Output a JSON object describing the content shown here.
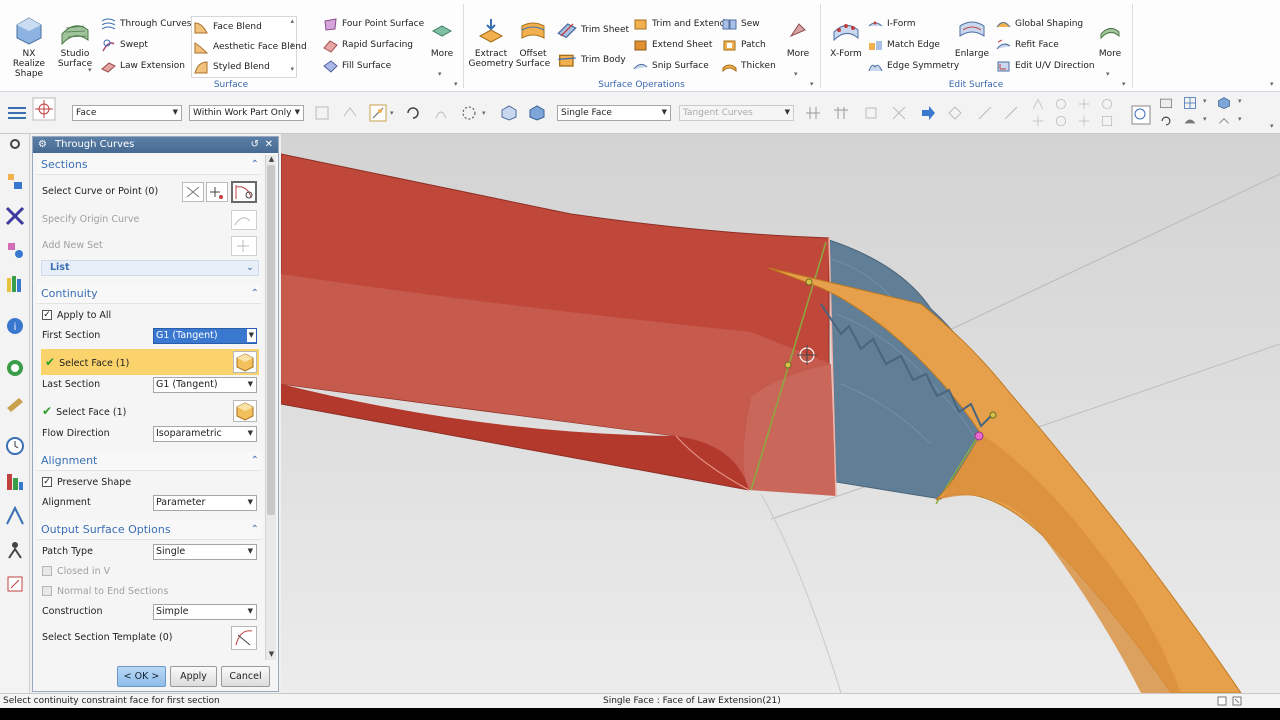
{
  "ribbon": {
    "surface_group": {
      "label": "Surface",
      "big_buttons": [
        "NX Realize Shape",
        "Studio Surface"
      ],
      "column1": [
        "Through Curves",
        "Swept",
        "Law Extension"
      ],
      "gallery": [
        "Face Blend",
        "Aesthetic Face Blend",
        "Styled Blend"
      ],
      "column3": [
        "Four Point Surface",
        "Rapid Surfacing",
        "Fill Surface"
      ],
      "more": "More"
    },
    "surface_ops_group": {
      "label": "Surface Operations",
      "big_buttons": [
        "Extract Geometry",
        "Offset Surface"
      ],
      "column1": [
        "Trim Sheet",
        "Trim Body"
      ],
      "column2": [
        "Trim and Extend",
        "Extend Sheet",
        "Snip Surface"
      ],
      "column3": [
        "Sew",
        "Patch",
        "Thicken"
      ],
      "more": "More"
    },
    "edit_surface_group": {
      "label": "Edit Surface",
      "big_buttons": [
        "X-Form",
        "Enlarge"
      ],
      "column1": [
        "I-Form",
        "Match Edge",
        "Edge Symmetry"
      ],
      "column2": [
        "Global Shaping",
        "Refit Face",
        "Edit U/V Direction"
      ],
      "more": "More"
    }
  },
  "selection_bar": {
    "type_filter": "Face",
    "scope": "Within Work Part Only",
    "face_rule": "Single Face",
    "curve_rule": "Tangent Curves"
  },
  "dialog": {
    "title": "Through Curves",
    "sections": {
      "title": "Sections",
      "select_curve": "Select Curve or Point (0)",
      "origin_curve": "Specify Origin Curve",
      "add_new_set": "Add New Set",
      "list": "List"
    },
    "continuity": {
      "title": "Continuity",
      "apply_to_all": "Apply to All",
      "first_section_label": "First Section",
      "first_section_value": "G1 (Tangent)",
      "first_face": "Select Face (1)",
      "last_section_label": "Last Section",
      "last_section_value": "G1 (Tangent)",
      "last_face": "Select Face (1)",
      "flow_direction_label": "Flow Direction",
      "flow_direction_value": "Isoparametric"
    },
    "alignment": {
      "title": "Alignment",
      "preserve_shape": "Preserve Shape",
      "alignment_label": "Alignment",
      "alignment_value": "Parameter"
    },
    "output": {
      "title": "Output Surface Options",
      "patch_type_label": "Patch Type",
      "patch_type_value": "Single",
      "closed_in_v": "Closed in V",
      "normal_to_end": "Normal to End Sections",
      "construction_label": "Construction",
      "construction_value": "Simple",
      "section_template": "Select Section Template (0)"
    },
    "buttons": {
      "ok": "< OK >",
      "apply": "Apply",
      "cancel": "Cancel"
    }
  },
  "status": {
    "prompt": "Select continuity constraint face for first section",
    "info": "Single Face : Face of Law Extension(21)"
  },
  "colors": {
    "red_surface": "#c0483a",
    "orange_surface": "#e6a04b",
    "blue_surface": "#607e96",
    "highlight": "#fbd36c",
    "accent": "#3a6fb4"
  }
}
